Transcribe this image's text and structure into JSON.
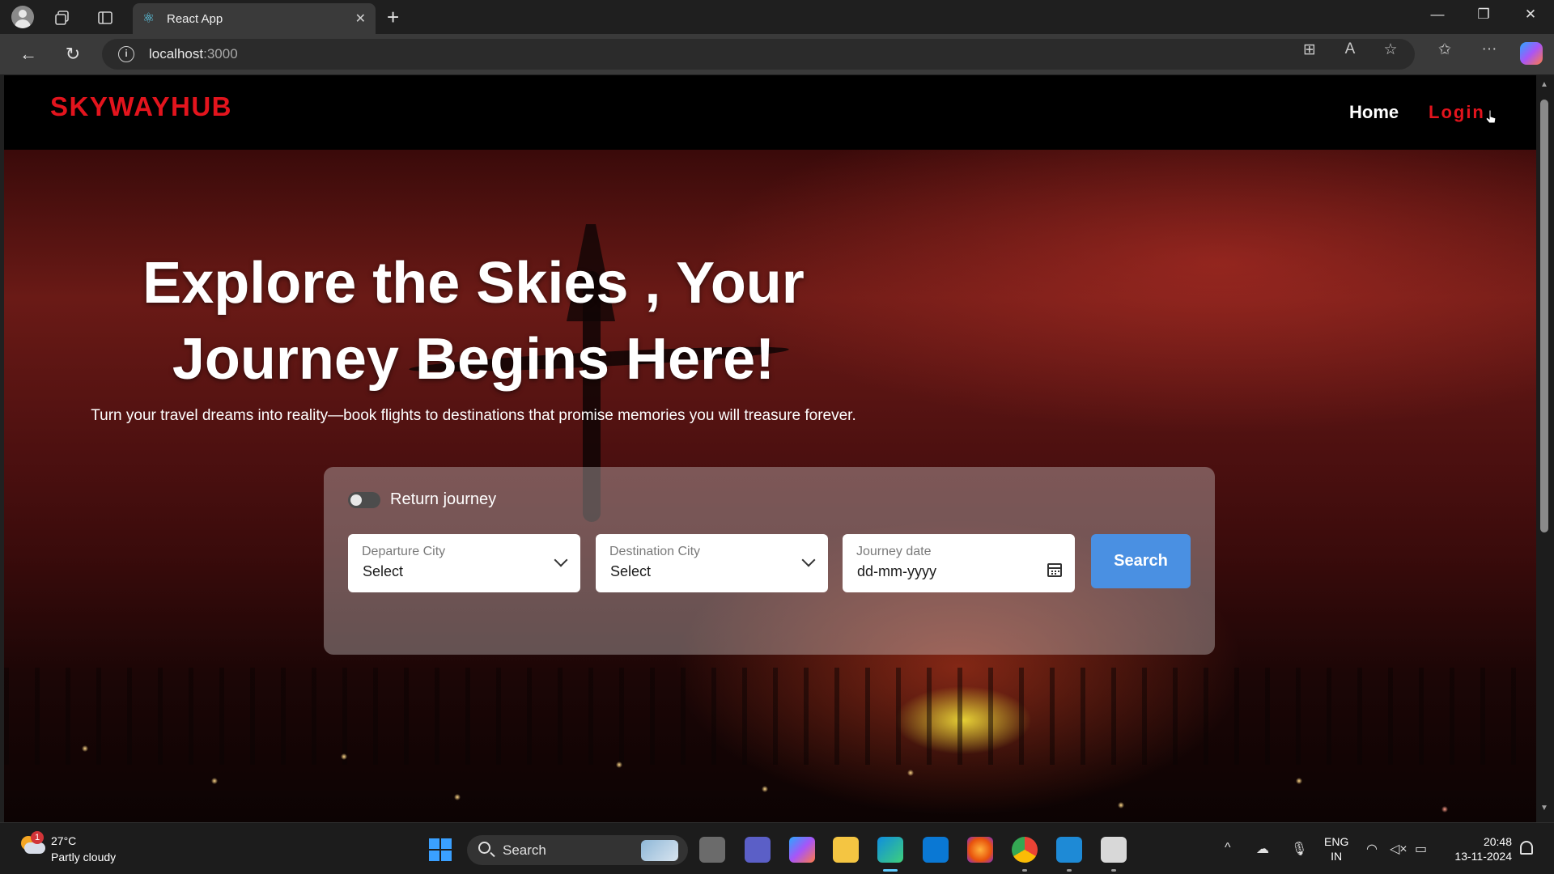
{
  "browser": {
    "tab_title": "React App",
    "url_host": "localhost",
    "url_port": ":3000"
  },
  "site": {
    "brand": "SKYWAYHUB",
    "nav": {
      "home": "Home",
      "login": "Login"
    },
    "hero": {
      "title": "Explore the Skies , Your Journey Begins Here!",
      "subtitle": "Turn your travel dreams into reality—book flights to destinations that promise memories you will treasure forever."
    },
    "search_form": {
      "return_toggle_label": "Return journey",
      "return_toggle_on": false,
      "departure": {
        "label": "Departure City",
        "value": "Select"
      },
      "destination": {
        "label": "Destination City",
        "value": "Select"
      },
      "date": {
        "label": "Journey date",
        "placeholder": "dd-mm-yyyy"
      },
      "search_button": "Search"
    }
  },
  "taskbar": {
    "weather": {
      "temp": "27°C",
      "desc": "Partly cloudy",
      "badge": "1"
    },
    "search_label": "Search",
    "lang": {
      "line1": "ENG",
      "line2": "IN"
    },
    "clock": {
      "time": "20:48",
      "date": "13-11-2024"
    }
  },
  "colors": {
    "brand_red": "#e3141d",
    "button_blue": "#4a90e2"
  }
}
